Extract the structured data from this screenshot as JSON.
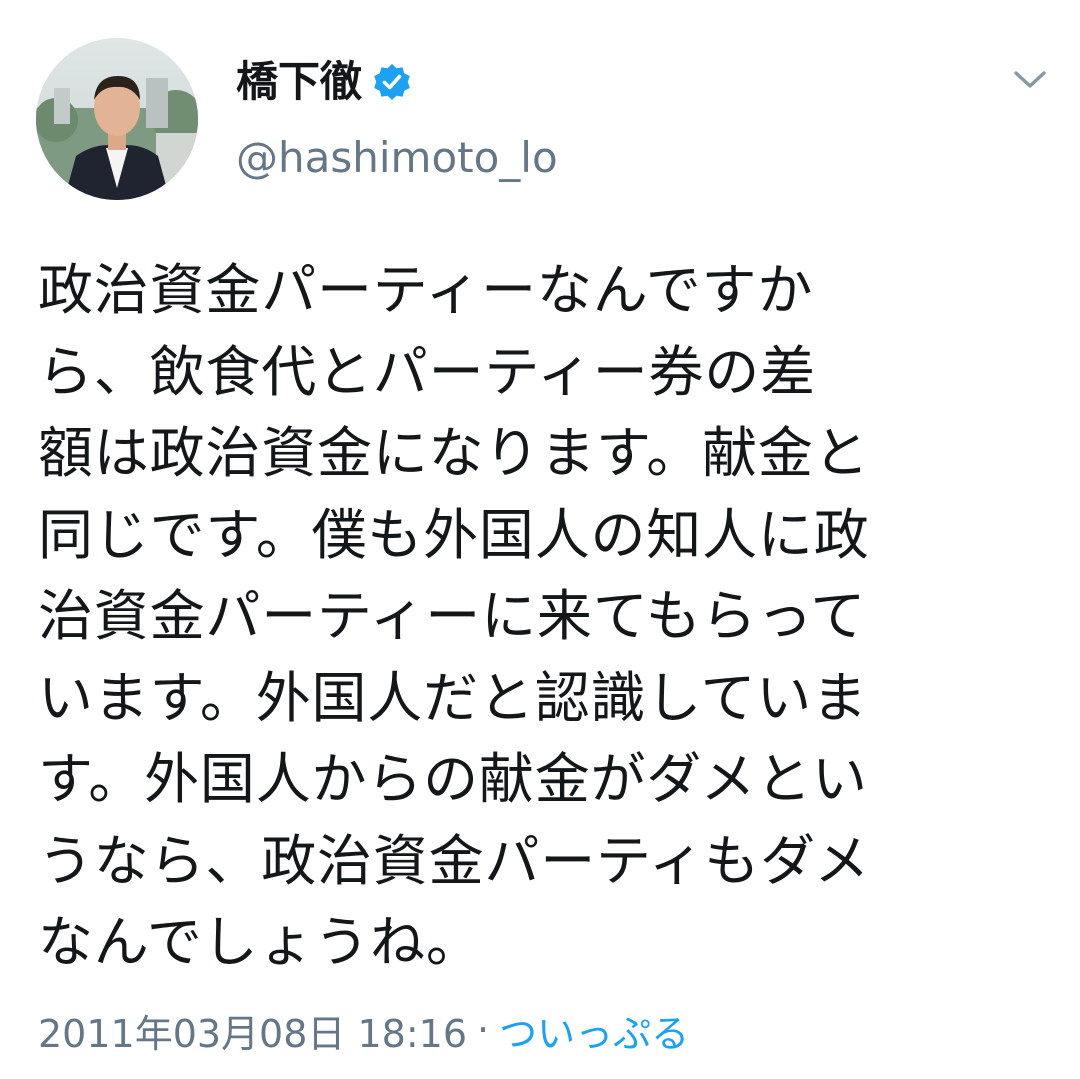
{
  "tweet": {
    "author": {
      "display_name": "橋下徹",
      "handle": "@hashimoto_lo",
      "verified": true
    },
    "body_lines": [
      "政治資金パーティーなんですか",
      "ら、飲食代とパーティー券の差",
      "額は政治資金になります。献金と",
      "同じです。僕も外国人の知人に政",
      "治資金パーティーに来てもらって",
      "います。外国人だと認識していま",
      "す。外国人からの献金がダメとい",
      "うなら、政治資金パーティもダメ",
      "なんでしょうね。"
    ],
    "timestamp": "2011年03月08日 18:16",
    "separator": "·",
    "client": "ついっぷる"
  },
  "icons": {
    "verified": "verified-badge-icon",
    "menu": "chevron-down-icon"
  },
  "colors": {
    "text": "#14171a",
    "secondary": "#657786",
    "accent": "#1da1f2"
  }
}
